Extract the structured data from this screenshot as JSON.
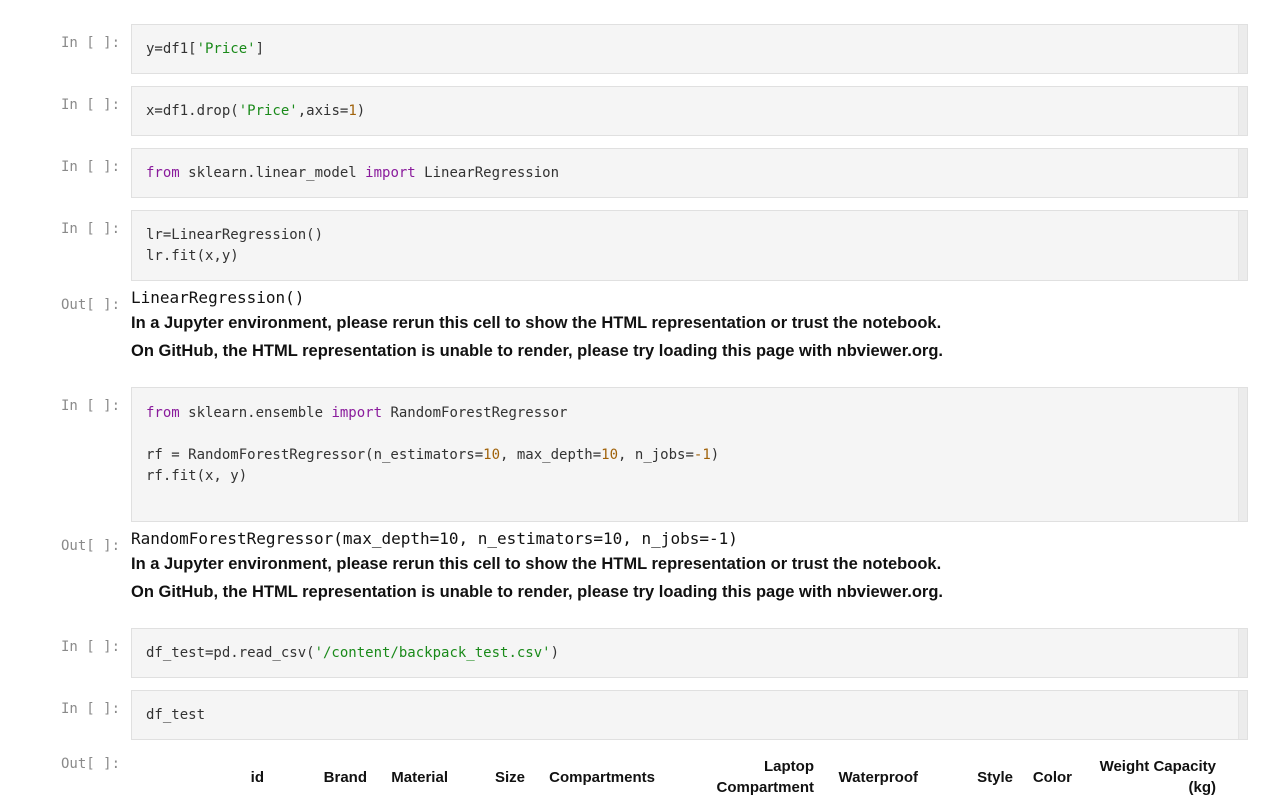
{
  "prompts": {
    "in": "In [ ]:",
    "out": "Out[ ]:"
  },
  "cells": {
    "c1": {
      "a": "y=df1[",
      "b": "'Price'",
      "c": "]"
    },
    "c2": {
      "a": "x=df1.drop(",
      "b": "'Price'",
      "c": ",axis=",
      "d": "1",
      "e": ")"
    },
    "c3": {
      "k1": "from",
      "m": " sklearn.linear_model ",
      "k2": "import",
      "n": " LinearRegression"
    },
    "c4": {
      "l1": "lr=LinearRegression()",
      "l2": "lr.fit(x,y)"
    },
    "c5": {
      "k1": "from",
      "m": " sklearn.ensemble ",
      "k2": "import",
      "n": " RandomForestRegressor",
      "r1": "rf = RandomForestRegressor(n_estimators=",
      "v1": "10",
      "r2": ", max_depth=",
      "v2": "10",
      "r3": ", n_jobs=",
      "v3": "-1",
      "r4": ")",
      "l3": "rf.fit(x, y)"
    },
    "c6": {
      "a": "df_test=pd.read_csv(",
      "b": "'/content/backpack_test.csv'",
      "c": ")"
    },
    "c7": {
      "a": "df_test"
    }
  },
  "outputs": {
    "o1": {
      "repr": "LinearRegression()",
      "warn1": "In a Jupyter environment, please rerun this cell to show the HTML representation or trust the notebook.",
      "warn2": "On GitHub, the HTML representation is unable to render, please try loading this page with nbviewer.org."
    },
    "o2": {
      "repr": "RandomForestRegressor(max_depth=10, n_estimators=10, n_jobs=-1)",
      "warn1": "In a Jupyter environment, please rerun this cell to show the HTML representation or trust the notebook.",
      "warn2": "On GitHub, the HTML representation is unable to render, please try loading this page with nbviewer.org."
    }
  },
  "table": {
    "headers": {
      "id": "id",
      "brand": "Brand",
      "material": "Material",
      "size": "Size",
      "compartments": "Compartments",
      "laptop_1": "Laptop",
      "laptop_2": "Compartment",
      "waterproof": "Waterproof",
      "style": "Style",
      "color": "Color",
      "weight_1": "Weight Capacity",
      "weight_2": "(kg)"
    }
  },
  "colors": {
    "keyword": "#8a1b9c",
    "string": "#1a8a1a",
    "number": "#a0620a",
    "cell_bg": "#f5f5f5"
  }
}
